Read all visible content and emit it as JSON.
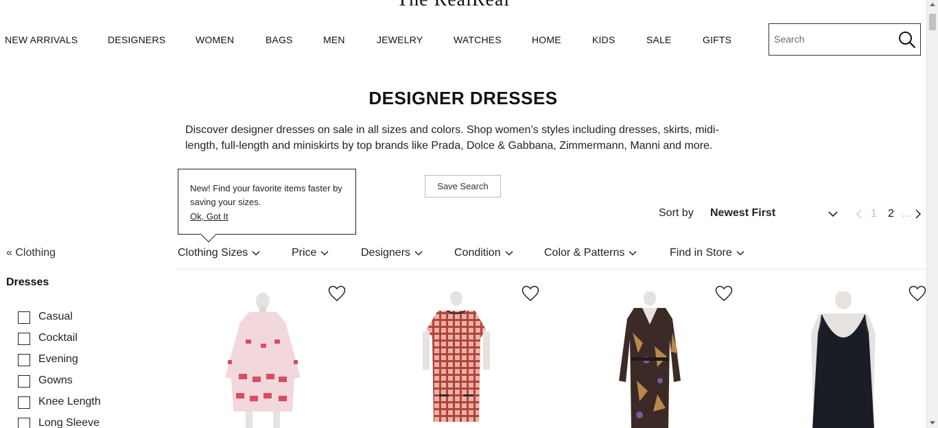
{
  "brand": {
    "logo_text": "The RealReal"
  },
  "nav": {
    "items": [
      "NEW ARRIVALS",
      "DESIGNERS",
      "WOMEN",
      "BAGS",
      "MEN",
      "JEWELRY",
      "WATCHES",
      "HOME",
      "KIDS",
      "SALE",
      "GIFTS"
    ]
  },
  "search": {
    "placeholder": "Search",
    "icon": "search-icon"
  },
  "page": {
    "title": "DESIGNER DRESSES",
    "description": "Discover designer dresses on sale in all sizes and colors. Shop women’s styles including dresses, skirts, midi-length, full-length and miniskirts by top brands like Prada, Dolce & Gabbana, Zimmermann, Manni and more."
  },
  "tooltip": {
    "text": "New! Find your favorite items faster by saving your sizes.",
    "link": "Ok, Got It"
  },
  "save_search": {
    "label": "Save Search"
  },
  "sort": {
    "label": "Sort by",
    "value": "Newest First"
  },
  "pagination": {
    "pages": [
      "1",
      "2"
    ],
    "current": "2",
    "ellipsis": "..."
  },
  "sidebar": {
    "back_link": "« Clothing",
    "heading": "Dresses",
    "categories": [
      "Casual",
      "Cocktail",
      "Evening",
      "Gowns",
      "Knee Length",
      "Long Sleeve"
    ]
  },
  "filters": [
    "Clothing Sizes",
    "Price",
    "Designers",
    "Condition",
    "Color & Patterns",
    "Find in Store"
  ],
  "products": [
    {
      "image": "pink-red-floral-mini-dress",
      "colors": {
        "main": "#f2d7dc",
        "accent": "#d94d5f"
      }
    },
    {
      "image": "red-plaid-tweed-dress",
      "colors": {
        "main": "#d9a08f",
        "accent": "#a83a32"
      }
    },
    {
      "image": "dark-floral-long-sleeve-gown",
      "colors": {
        "main": "#3b2a26",
        "accent": "#b8894a"
      }
    },
    {
      "image": "black-sleeveless-dress",
      "colors": {
        "main": "#1a1d24",
        "accent": "#2b2f38"
      }
    }
  ]
}
